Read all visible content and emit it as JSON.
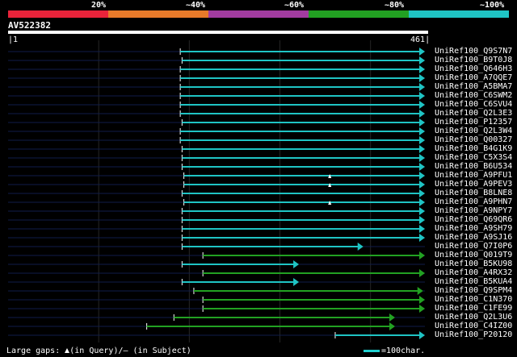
{
  "legend": {
    "percentages": [
      "20%",
      "~40%",
      "~60%",
      "~80%",
      "~100%"
    ],
    "colors": [
      "#e8233a",
      "#e87a2a",
      "#a23ca0",
      "#22a122",
      "#1fc4c4"
    ]
  },
  "query": {
    "name": "AV522382",
    "start": "1",
    "end": "461",
    "length": 461
  },
  "hits": [
    {
      "name": "UniRef100_Q9S7N7",
      "qstart": 191,
      "qend": 461,
      "color": "#1fc4c4"
    },
    {
      "name": "UniRef100_B9T0J8",
      "qstart": 193,
      "qend": 461,
      "color": "#1fc4c4"
    },
    {
      "name": "UniRef100_Q646H3",
      "qstart": 191,
      "qend": 461,
      "color": "#1fc4c4"
    },
    {
      "name": "UniRef100_A7QQE7",
      "qstart": 191,
      "qend": 461,
      "color": "#1fc4c4"
    },
    {
      "name": "UniRef100_A5BMA7",
      "qstart": 191,
      "qend": 461,
      "color": "#1fc4c4"
    },
    {
      "name": "UniRef100_C6SWM2",
      "qstart": 191,
      "qend": 461,
      "color": "#1fc4c4"
    },
    {
      "name": "UniRef100_C6SVU4",
      "qstart": 191,
      "qend": 461,
      "color": "#1fc4c4"
    },
    {
      "name": "UniRef100_Q2L3E3",
      "qstart": 191,
      "qend": 461,
      "color": "#1fc4c4"
    },
    {
      "name": "UniRef100_P12357",
      "qstart": 193,
      "qend": 461,
      "color": "#1fc4c4"
    },
    {
      "name": "UniRef100_Q2L3W4",
      "qstart": 191,
      "qend": 461,
      "color": "#1fc4c4"
    },
    {
      "name": "UniRef100_Q00327",
      "qstart": 191,
      "qend": 461,
      "color": "#1fc4c4"
    },
    {
      "name": "UniRef100_B4G1K9",
      "qstart": 193,
      "qend": 461,
      "color": "#1fc4c4"
    },
    {
      "name": "UniRef100_C5X3S4",
      "qstart": 193,
      "qend": 461,
      "color": "#1fc4c4"
    },
    {
      "name": "UniRef100_B6U534",
      "qstart": 193,
      "qend": 461,
      "color": "#1fc4c4"
    },
    {
      "name": "UniRef100_A9PFU1",
      "qstart": 195,
      "qend": 461,
      "color": "#1fc4c4",
      "gap": 356
    },
    {
      "name": "UniRef100_A9PEV3",
      "qstart": 195,
      "qend": 461,
      "color": "#1fc4c4",
      "gap": 356
    },
    {
      "name": "UniRef100_B8LNE8",
      "qstart": 193,
      "qend": 461,
      "color": "#1fc4c4"
    },
    {
      "name": "UniRef100_A9PHN7",
      "qstart": 195,
      "qend": 461,
      "color": "#1fc4c4",
      "gap": 356
    },
    {
      "name": "UniRef100_A9NPY7",
      "qstart": 193,
      "qend": 461,
      "color": "#1fc4c4"
    },
    {
      "name": "UniRef100_Q69QR6",
      "qstart": 193,
      "qend": 461,
      "color": "#1fc4c4"
    },
    {
      "name": "UniRef100_A9SH79",
      "qstart": 193,
      "qend": 461,
      "color": "#1fc4c4"
    },
    {
      "name": "UniRef100_A9SJ16",
      "qstart": 193,
      "qend": 461,
      "color": "#1fc4c4"
    },
    {
      "name": "UniRef100_Q7I0P6",
      "qstart": 193,
      "qend": 393,
      "color": "#1fc4c4"
    },
    {
      "name": "UniRef100_Q019T9",
      "qstart": 216,
      "qend": 461,
      "color": "#22a122"
    },
    {
      "name": "UniRef100_B5KU98",
      "qstart": 193,
      "qend": 322,
      "color": "#1fc4c4"
    },
    {
      "name": "UniRef100_A4RX32",
      "qstart": 216,
      "qend": 461,
      "color": "#22a122"
    },
    {
      "name": "UniRef100_B5KUA4",
      "qstart": 193,
      "qend": 322,
      "color": "#1fc4c4"
    },
    {
      "name": "UniRef100_Q9SPM4",
      "qstart": 206,
      "qend": 459,
      "color": "#22a122"
    },
    {
      "name": "UniRef100_C1N370",
      "qstart": 216,
      "qend": 461,
      "color": "#22a122"
    },
    {
      "name": "UniRef100_C1FE99",
      "qstart": 216,
      "qend": 461,
      "color": "#22a122"
    },
    {
      "name": "UniRef100_Q2L3U6",
      "qstart": 184,
      "qend": 428,
      "color": "#22a122"
    },
    {
      "name": "UniRef100_C4IZ00",
      "qstart": 154,
      "qend": 428,
      "color": "#22a122"
    },
    {
      "name": "UniRef100_P20120",
      "qstart": 362,
      "qend": 461,
      "color": "#1fc4c4"
    }
  ],
  "footer": {
    "gaps_prefix": "Large gaps:",
    "gaps_query": "(in Query)/",
    "gaps_subject": "– (in Subject)",
    "scale_label": "=100char."
  }
}
